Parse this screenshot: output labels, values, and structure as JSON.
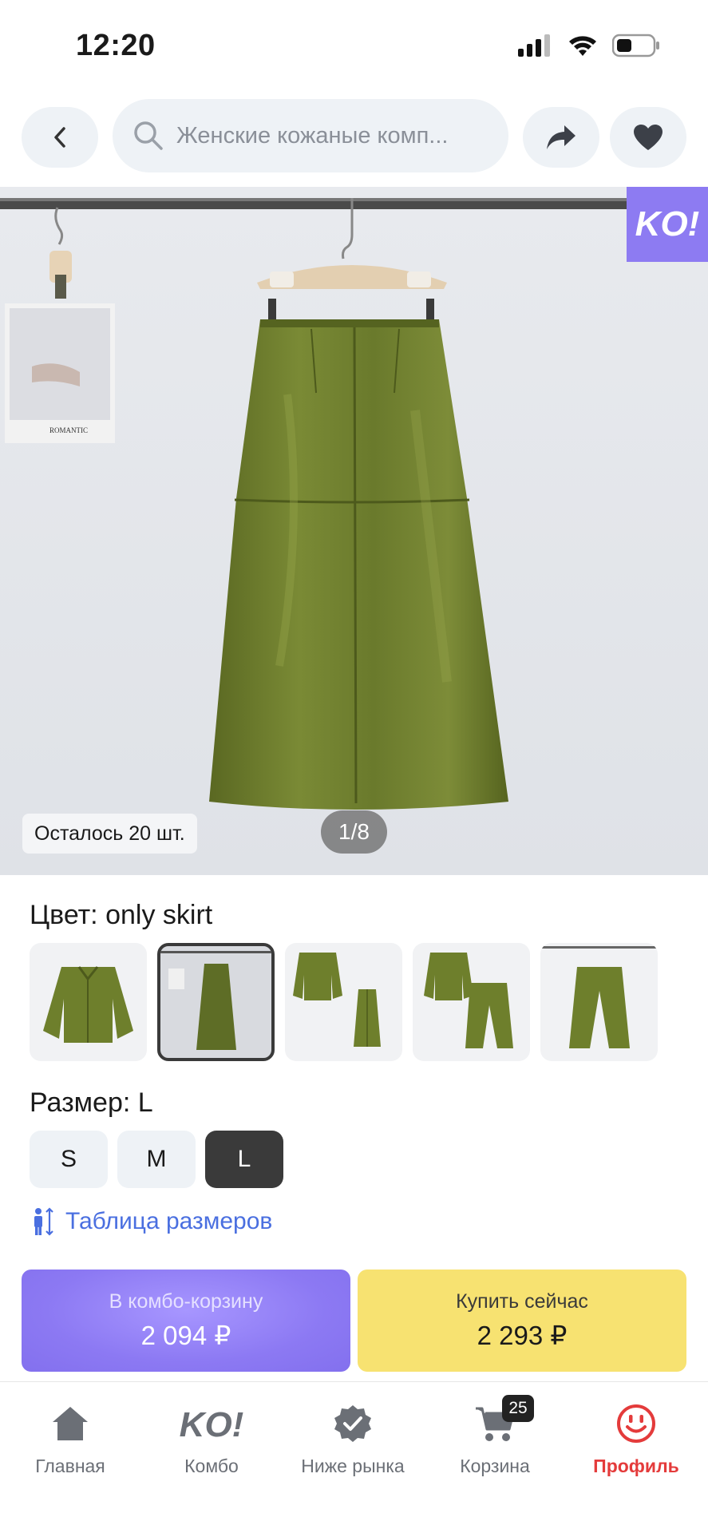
{
  "status_bar": {
    "time": "12:20"
  },
  "header": {
    "search_placeholder": "Женские кожаные комп...",
    "icons": [
      "chevron-left-icon",
      "search-icon",
      "share-icon",
      "heart-icon"
    ]
  },
  "gallery": {
    "badge": "KO!",
    "stock": "Осталось 20 шт.",
    "page_indicator": "1/8",
    "photo_caption": "ROMANTIC"
  },
  "color": {
    "label": "Цвет: only skirt",
    "selected_index": 1,
    "swatches": [
      "jacket",
      "only skirt",
      "jacket + skirt",
      "jacket + pants",
      "pants"
    ]
  },
  "size": {
    "label": "Размер: L",
    "options": [
      "S",
      "M",
      "L"
    ],
    "selected": "L",
    "size_table_link": "Таблица размеров"
  },
  "actions": {
    "combo_label": "В комбо-корзину",
    "combo_price": "2 094 ₽",
    "buy_label": "Купить сейчас",
    "buy_price": "2 293 ₽"
  },
  "tabbar": {
    "items": [
      {
        "label": "Главная",
        "icon": "home-icon"
      },
      {
        "label": "Комбо",
        "icon": "ko-logo-icon"
      },
      {
        "label": "Ниже рынка",
        "icon": "badge-check-icon"
      },
      {
        "label": "Корзина",
        "icon": "cart-icon",
        "badge": "25"
      },
      {
        "label": "Профиль",
        "icon": "profile-icon",
        "active": true
      }
    ]
  },
  "colors": {
    "accent_purple": "#8d7bf2",
    "buy_yellow": "#f7e271",
    "link_blue": "#4a6fe0",
    "active_red": "#e43b3b",
    "skirt_green": "#6b7a2a"
  }
}
